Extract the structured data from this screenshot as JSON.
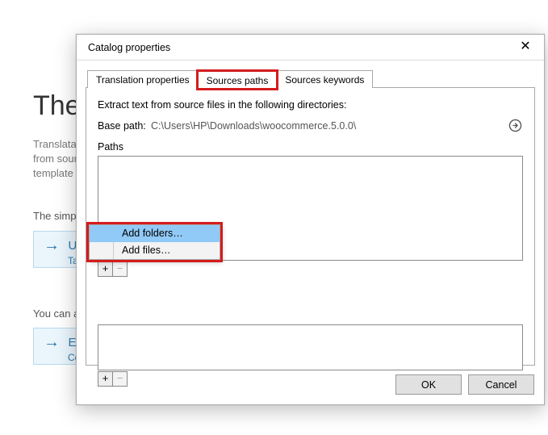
{
  "background": {
    "title_fragment": "The",
    "desc_fragment": "Translatabl\nfrom sourc\ntemplate fi",
    "line1": "The simple",
    "btn1_title": "Upd",
    "btn1_sub": "Take",
    "line2": "You can als",
    "btn2_title": "Extr",
    "btn2_sub": "Conf"
  },
  "dialog": {
    "title": "Catalog properties",
    "tabs": {
      "translation": "Translation properties",
      "sources_paths": "Sources paths",
      "sources_keywords": "Sources keywords"
    },
    "extract_label": "Extract text from source files in the following directories:",
    "basepath_label": "Base path:",
    "basepath_value": "C:\\Users\\HP\\Downloads\\woocommerce.5.0.0\\",
    "paths_label": "Paths",
    "ok_label": "OK",
    "cancel_label": "Cancel"
  },
  "popup": {
    "add_folders": "Add folders…",
    "add_files": "Add files…"
  }
}
